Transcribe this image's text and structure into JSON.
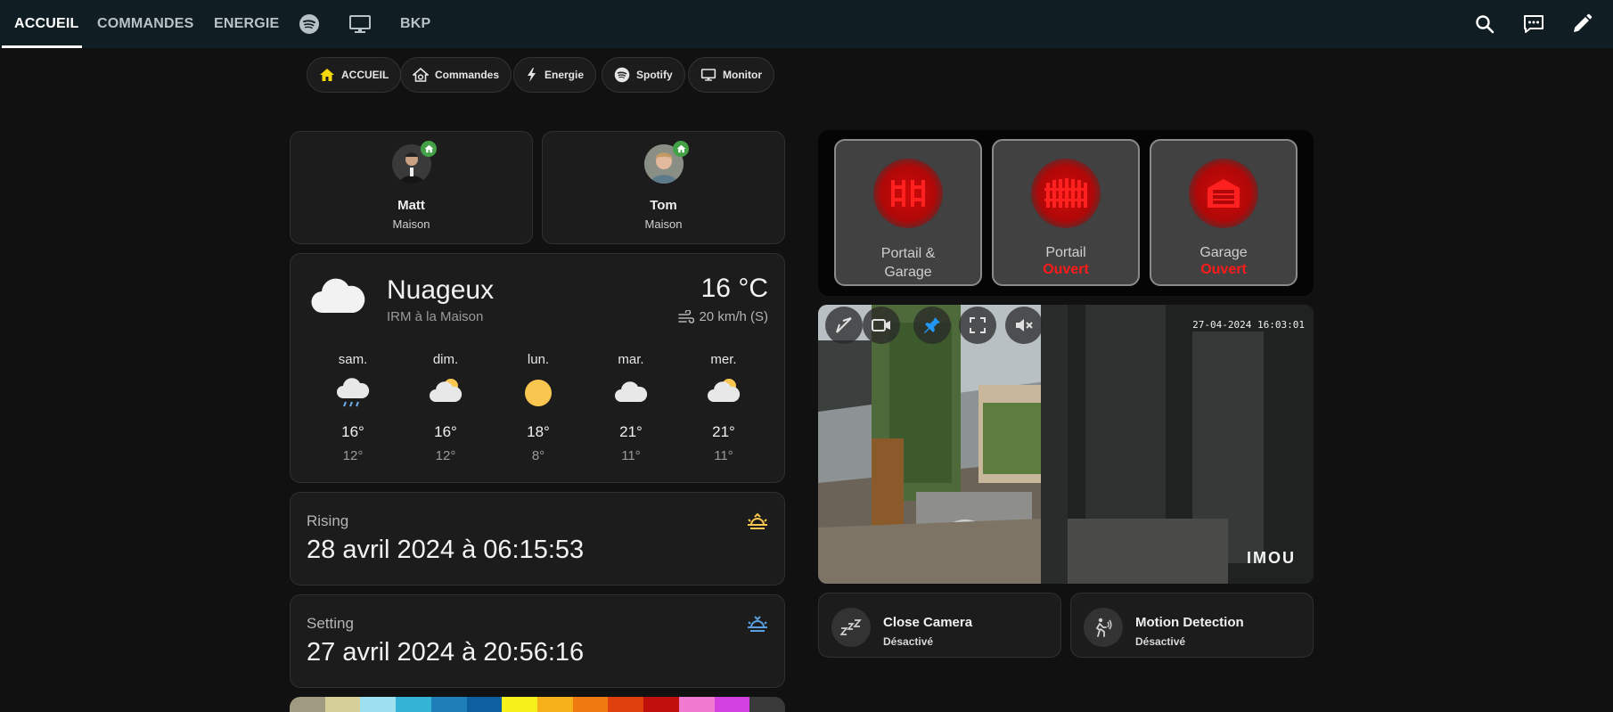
{
  "tabs": [
    "ACCUEIL",
    "COMMANDES",
    "ENERGIE",
    "BKP"
  ],
  "tab_icons": [
    "spotify-icon",
    "monitor-icon"
  ],
  "toolbar_icons": [
    "search-icon",
    "assist-icon",
    "edit-icon"
  ],
  "chips": [
    {
      "label": "ACCUEIL",
      "icon": "home-icon"
    },
    {
      "label": "Commandes",
      "icon": "house-gear-icon"
    },
    {
      "label": "Energie",
      "icon": "lightning-icon"
    },
    {
      "label": "Spotify",
      "icon": "spotify-icon"
    },
    {
      "label": "Monitor",
      "icon": "monitor-icon"
    }
  ],
  "persons": [
    {
      "name": "Matt",
      "state": "Maison"
    },
    {
      "name": "Tom",
      "state": "Maison"
    }
  ],
  "weather": {
    "condition": "Nuageux",
    "source": "IRM à la Maison",
    "temperature": "16 °C",
    "wind": "20 km/h (S)",
    "forecast": [
      {
        "day": "sam.",
        "icon": "rain-cloud-icon",
        "high": "16°",
        "low": "12°"
      },
      {
        "day": "dim.",
        "icon": "partly-cloudy-icon",
        "high": "16°",
        "low": "12°"
      },
      {
        "day": "lun.",
        "icon": "sun-icon",
        "high": "18°",
        "low": "8°"
      },
      {
        "day": "mar.",
        "icon": "cloud-icon",
        "high": "21°",
        "low": "11°"
      },
      {
        "day": "mer.",
        "icon": "partly-cloudy-icon",
        "high": "21°",
        "low": "11°"
      }
    ]
  },
  "sun": {
    "rising_title": "Rising",
    "rising_value": "28 avril 2024 à 06:15:53",
    "setting_title": "Setting",
    "setting_value": "27 avril 2024 à 20:56:16"
  },
  "gates": [
    {
      "label_line1": "Portail &",
      "label_line2": "Garage",
      "state": ""
    },
    {
      "label_line1": "Portail",
      "label_line2": "",
      "state": "Ouvert"
    },
    {
      "label_line1": "Garage",
      "label_line2": "",
      "state": "Ouvert"
    }
  ],
  "camera": {
    "timestamp": "27-04-2024 16:03:01",
    "brand": "IMOU"
  },
  "camera_entities": [
    {
      "name": "Close Camera",
      "state": "Désactivé",
      "icon": "sleep-icon"
    },
    {
      "name": "Motion Detection",
      "state": "Désactivé",
      "icon": "motion-sensor-icon"
    }
  ],
  "colors": {
    "topbar": "#101e24",
    "background": "#111111",
    "card": "#1c1c1c",
    "alert_red": "#ff1a1a",
    "sun_yellow": "#f9c74f",
    "home_badge": "#43a047"
  }
}
